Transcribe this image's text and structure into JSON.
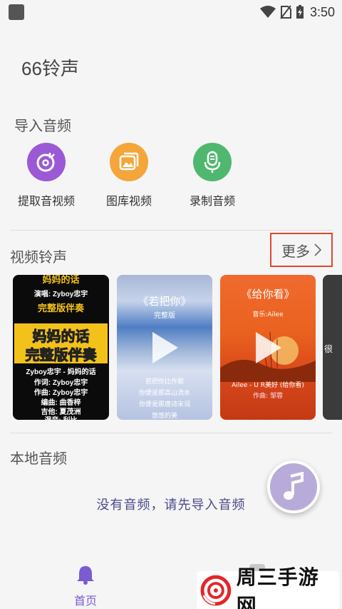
{
  "status_bar": {
    "time": "3:50"
  },
  "app": {
    "title": "66铃声"
  },
  "import_section": {
    "title": "导入音频",
    "items": [
      {
        "label": "提取音视频",
        "icon": "disc-music-icon",
        "color": "#9b59d6"
      },
      {
        "label": "图库视频",
        "icon": "gallery-icon",
        "color": "#f4a63a"
      },
      {
        "label": "录制音频",
        "icon": "microphone-icon",
        "color": "#4fb86e"
      }
    ]
  },
  "video_section": {
    "title": "视频铃声",
    "more_label": "更多",
    "cards": [
      {
        "top": "妈妈的话",
        "line1": "演唱: Zyboy忠宇",
        "line2": "完整版伴奏",
        "banner1": "妈妈的话",
        "banner2": "完整版伴奏",
        "line3": "Zyboy忠宇 - 妈妈的话",
        "line4": "作词: Zyboy忠宇",
        "line5": "作曲: Zyboy忠宇",
        "line6": "编曲: 曲香梓",
        "line7": "吉他: 夏茂洲",
        "line8": "混音: 利比"
      },
      {
        "title": "《若把你》",
        "subtitle": "完整版",
        "lyric1": "若把你比作歌",
        "lyric2": "你便是那高山流水",
        "lyric3": "你便是那唐诗宋词",
        "lyric4": "悠悠的美"
      },
      {
        "title": "《给你看》",
        "singer": "音乐:Ailee",
        "credit": "Ailee - U R美好 (给你看)",
        "sub": "作曲: 邹蓉"
      },
      {
        "partial": "很"
      }
    ]
  },
  "local_section": {
    "title": "本地音频",
    "empty_text": "没有音频，请先导入音频"
  },
  "bottom_nav": {
    "home_label": "首页"
  },
  "watermark": {
    "text": "周三手游网"
  }
}
